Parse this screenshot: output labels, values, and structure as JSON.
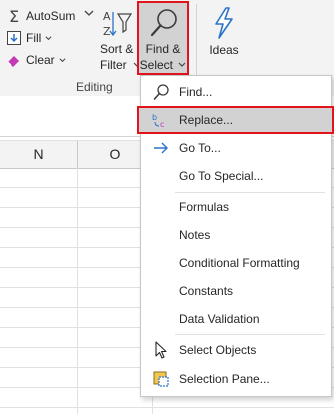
{
  "ribbon": {
    "autosum_label": "AutoSum",
    "fill_label": "Fill",
    "clear_label": "Clear",
    "sort_filter_line1": "Sort &",
    "sort_filter_line2": "Filter",
    "find_select_line1": "Find &",
    "find_select_line2": "Select",
    "ideas_label": "Ideas",
    "group_label": "Editing"
  },
  "columns": [
    "N",
    "O"
  ],
  "menu": {
    "items": [
      {
        "label": "Find...",
        "icon": "magnifier-icon"
      },
      {
        "label": "Replace...",
        "icon": "replace-icon"
      },
      {
        "label": "Go To...",
        "icon": "arrow-right-icon"
      },
      {
        "label": "Go To Special..."
      },
      {
        "label": "Formulas"
      },
      {
        "label": "Notes"
      },
      {
        "label": "Conditional Formatting"
      },
      {
        "label": "Constants"
      },
      {
        "label": "Data Validation"
      },
      {
        "label": "Select Objects",
        "icon": "pointer-icon"
      },
      {
        "label": "Selection Pane...",
        "icon": "selection-pane-icon"
      }
    ]
  },
  "colors": {
    "highlight_border": "#e1141e",
    "accent_blue": "#2b73c7"
  }
}
